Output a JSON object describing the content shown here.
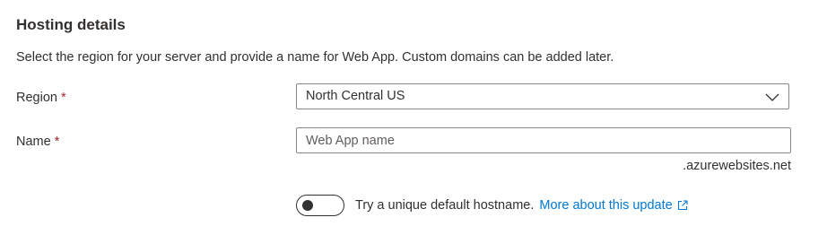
{
  "section": {
    "title": "Hosting details",
    "description": "Select the region for your server and provide a name for Web App. Custom domains can be added later."
  },
  "region": {
    "label": "Region",
    "required_mark": "*",
    "selected_value": "North Central US",
    "icon": "chevron-down-icon"
  },
  "name": {
    "label": "Name",
    "required_mark": "*",
    "value": "",
    "placeholder": "Web App name",
    "suffix": ".azurewebsites.net"
  },
  "hostname_toggle": {
    "state": "off",
    "label": "Try a unique default hostname.",
    "link_text": "More about this update",
    "link_icon": "external-link-icon"
  },
  "colors": {
    "text": "#323130",
    "required": "#a4262c",
    "link": "#0078d4",
    "border": "#8a8886",
    "placeholder": "#605e5c"
  }
}
